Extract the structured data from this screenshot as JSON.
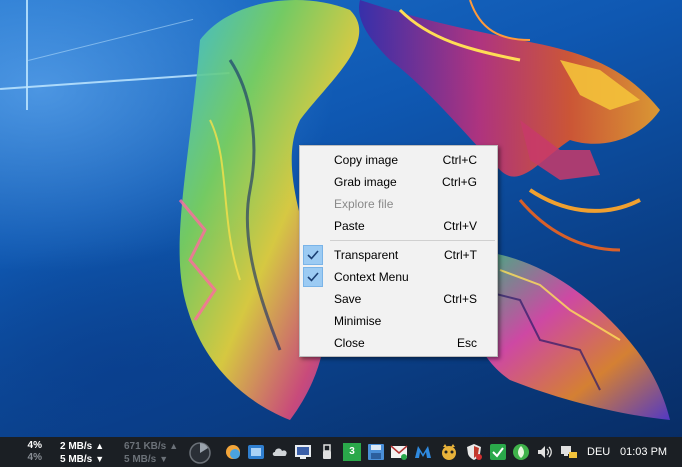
{
  "context_menu": {
    "items": [
      {
        "label": "Copy image",
        "shortcut": "Ctrl+C"
      },
      {
        "label": "Grab image",
        "shortcut": "Ctrl+G"
      },
      {
        "label": "Explore file",
        "shortcut": ""
      },
      {
        "label": "Paste",
        "shortcut": "Ctrl+V"
      },
      {
        "label": "Transparent",
        "shortcut": "Ctrl+T"
      },
      {
        "label": "Context Menu",
        "shortcut": ""
      },
      {
        "label": "Save",
        "shortcut": "Ctrl+S"
      },
      {
        "label": "Minimise",
        "shortcut": ""
      },
      {
        "label": "Close",
        "shortcut": "Esc"
      }
    ]
  },
  "taskbar": {
    "cpu_top": "4%",
    "cpu_bottom": "4%",
    "upload_rate": "2 MB/s",
    "download_rate": "5 MB/s",
    "upload_rate_2": "671 KB/s",
    "download_rate_2": "5 MB/s",
    "up_arrow": "▲",
    "down_arrow": "▼",
    "language": "DEU",
    "time": "01:03 PM",
    "tray_icons": [
      "pie-gauge-icon",
      "weather-icon",
      "app-icon",
      "cloud-icon",
      "monitor-icon",
      "usb-icon",
      "badge-3-icon",
      "save-icon",
      "mail-icon",
      "malwarebytes-icon",
      "pet-icon",
      "shield-icon",
      "checkbox-icon",
      "leaf-icon",
      "speaker-icon",
      "network-icon"
    ],
    "badge_value": "3"
  },
  "colors": {
    "menu_bg": "#f2f2f2",
    "check_bg": "#9ccbf3",
    "taskbar_bg": "#1b1f24",
    "disabled_text": "#8a8a8a"
  }
}
